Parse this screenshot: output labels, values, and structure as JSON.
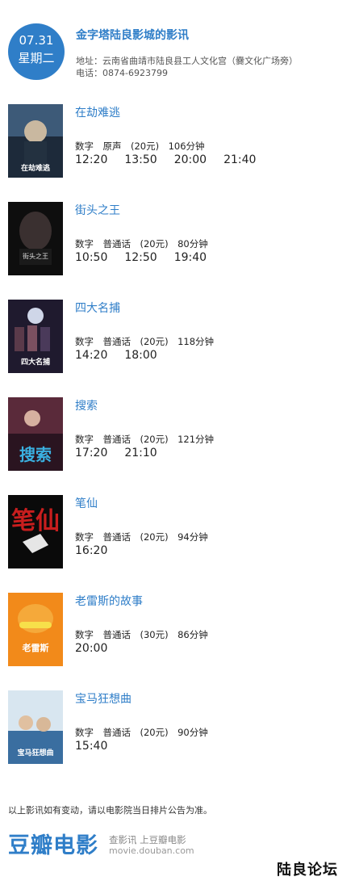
{
  "header": {
    "date": "07.31",
    "weekday": "星期二",
    "cinema_name": "金字塔陆良影城的影讯",
    "address": "地址：云南省曲靖市陆良县工人文化宫（爨文化广场旁）",
    "phone": "电话：0874-6923799"
  },
  "movies": [
    {
      "title": "在劫难逃",
      "info": "数字　原声　(20元)　106分钟",
      "times": [
        "12:20",
        "13:50",
        "20:00",
        "21:40"
      ],
      "poster_text": "在劫难逃"
    },
    {
      "title": "街头之王",
      "info": "数字　普通话　(20元)　80分钟",
      "times": [
        "10:50",
        "12:50",
        "19:40"
      ],
      "poster_text": "街头之王"
    },
    {
      "title": "四大名捕",
      "info": "数字　普通话　(20元)　118分钟",
      "times": [
        "14:20",
        "18:00"
      ],
      "poster_text": "四大名捕"
    },
    {
      "title": "搜索",
      "info": "数字　普通话　(20元)　121分钟",
      "times": [
        "17:20",
        "21:10"
      ],
      "poster_text": "搜索"
    },
    {
      "title": "笔仙",
      "info": "数字　普通话　(20元)　94分钟",
      "times": [
        "16:20"
      ],
      "poster_text": "笔仙"
    },
    {
      "title": "老雷斯的故事",
      "info": "数字　普通话　(30元)　86分钟",
      "times": [
        "20:00"
      ],
      "poster_text": "老雷斯"
    },
    {
      "title": "宝马狂想曲",
      "info": "数字　普通话　(20元)　90分钟",
      "times": [
        "15:40"
      ],
      "poster_text": "宝马狂想曲"
    }
  ],
  "footer": {
    "notice": "以上影讯如有变动，请以电影院当日排片公告为准。",
    "logo": "豆瓣电影",
    "tagline": "查影讯  上豆瓣电影",
    "site": "movie.douban.com",
    "watermark": "陆良论坛"
  },
  "colors": {
    "accent": "#2f7ec8"
  }
}
